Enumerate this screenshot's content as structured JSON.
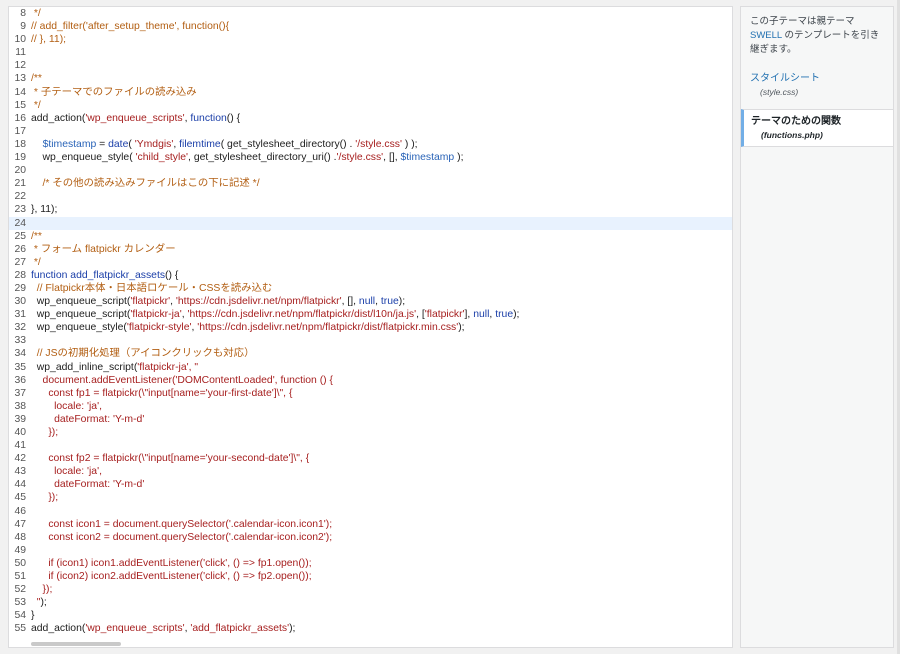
{
  "editor": {
    "lines": [
      {
        "n": "8",
        "tokens": [
          {
            "t": " */",
            "c": "c"
          }
        ]
      },
      {
        "n": "9",
        "tokens": [
          {
            "t": "// add_filter('after_setup_theme', function(){",
            "c": "c"
          }
        ]
      },
      {
        "n": "10",
        "tokens": [
          {
            "t": "// }, 11);",
            "c": "c"
          }
        ]
      },
      {
        "n": "11",
        "tokens": []
      },
      {
        "n": "12",
        "tokens": []
      },
      {
        "n": "13",
        "tokens": [
          {
            "t": "/**",
            "c": "c"
          }
        ]
      },
      {
        "n": "14",
        "tokens": [
          {
            "t": " * 子テーマでのファイルの読み込み",
            "c": "c"
          }
        ]
      },
      {
        "n": "15",
        "tokens": [
          {
            "t": " */",
            "c": "c"
          }
        ]
      },
      {
        "n": "16",
        "tokens": [
          {
            "t": "add_action(",
            "c": "n"
          },
          {
            "t": "'wp_enqueue_scripts'",
            "c": "s"
          },
          {
            "t": ", ",
            "c": "n"
          },
          {
            "t": "function",
            "c": "k"
          },
          {
            "t": "() {",
            "c": "n"
          }
        ]
      },
      {
        "n": "17",
        "tokens": []
      },
      {
        "n": "18",
        "tokens": [
          {
            "t": "    ",
            "c": "n"
          },
          {
            "t": "$timestamp",
            "c": "v"
          },
          {
            "t": " = ",
            "c": "n"
          },
          {
            "t": "date",
            "c": "k"
          },
          {
            "t": "( ",
            "c": "n"
          },
          {
            "t": "'Ymdgis'",
            "c": "s"
          },
          {
            "t": ", ",
            "c": "n"
          },
          {
            "t": "filemtime",
            "c": "k"
          },
          {
            "t": "( get_stylesheet_directory() . ",
            "c": "n"
          },
          {
            "t": "'/style.css'",
            "c": "s"
          },
          {
            "t": " ) );",
            "c": "n"
          }
        ]
      },
      {
        "n": "19",
        "tokens": [
          {
            "t": "    wp_enqueue_style( ",
            "c": "n"
          },
          {
            "t": "'child_style'",
            "c": "s"
          },
          {
            "t": ", get_stylesheet_directory_uri() .",
            "c": "n"
          },
          {
            "t": "'/style.css'",
            "c": "s"
          },
          {
            "t": ", [], ",
            "c": "n"
          },
          {
            "t": "$timestamp",
            "c": "v"
          },
          {
            "t": " );",
            "c": "n"
          }
        ]
      },
      {
        "n": "20",
        "tokens": []
      },
      {
        "n": "21",
        "tokens": [
          {
            "t": "    /* その他の読み込みファイルはこの下に記述 */",
            "c": "c"
          }
        ]
      },
      {
        "n": "22",
        "tokens": []
      },
      {
        "n": "23",
        "tokens": [
          {
            "t": "}, 11);",
            "c": "n"
          }
        ]
      },
      {
        "n": "24",
        "tokens": [],
        "active": true
      },
      {
        "n": "25",
        "tokens": [
          {
            "t": "/**",
            "c": "c"
          }
        ]
      },
      {
        "n": "26",
        "tokens": [
          {
            "t": " * フォーム flatpickr カレンダー",
            "c": "c"
          }
        ]
      },
      {
        "n": "27",
        "tokens": [
          {
            "t": " */",
            "c": "c"
          }
        ]
      },
      {
        "n": "28",
        "tokens": [
          {
            "t": "function",
            "c": "k"
          },
          {
            "t": " ",
            "c": "n"
          },
          {
            "t": "add_flatpickr_assets",
            "c": "k"
          },
          {
            "t": "() {",
            "c": "n"
          }
        ]
      },
      {
        "n": "29",
        "tokens": [
          {
            "t": "  // Flatpickr本体・日本語ロケール・CSSを読み込む",
            "c": "c"
          }
        ]
      },
      {
        "n": "30",
        "tokens": [
          {
            "t": "  wp_enqueue_script(",
            "c": "n"
          },
          {
            "t": "'flatpickr'",
            "c": "s"
          },
          {
            "t": ", ",
            "c": "n"
          },
          {
            "t": "'https://cdn.jsdelivr.net/npm/flatpickr'",
            "c": "s"
          },
          {
            "t": ", [], ",
            "c": "n"
          },
          {
            "t": "null",
            "c": "k"
          },
          {
            "t": ", ",
            "c": "n"
          },
          {
            "t": "true",
            "c": "k"
          },
          {
            "t": ");",
            "c": "n"
          }
        ]
      },
      {
        "n": "31",
        "tokens": [
          {
            "t": "  wp_enqueue_script(",
            "c": "n"
          },
          {
            "t": "'flatpickr-ja'",
            "c": "s"
          },
          {
            "t": ", ",
            "c": "n"
          },
          {
            "t": "'https://cdn.jsdelivr.net/npm/flatpickr/dist/l10n/ja.js'",
            "c": "s"
          },
          {
            "t": ", [",
            "c": "n"
          },
          {
            "t": "'flatpickr'",
            "c": "s"
          },
          {
            "t": "], ",
            "c": "n"
          },
          {
            "t": "null",
            "c": "k"
          },
          {
            "t": ", ",
            "c": "n"
          },
          {
            "t": "true",
            "c": "k"
          },
          {
            "t": ");",
            "c": "n"
          }
        ]
      },
      {
        "n": "32",
        "tokens": [
          {
            "t": "  wp_enqueue_style(",
            "c": "n"
          },
          {
            "t": "'flatpickr-style'",
            "c": "s"
          },
          {
            "t": ", ",
            "c": "n"
          },
          {
            "t": "'https://cdn.jsdelivr.net/npm/flatpickr/dist/flatpickr.min.css'",
            "c": "s"
          },
          {
            "t": ");",
            "c": "n"
          }
        ]
      },
      {
        "n": "33",
        "tokens": []
      },
      {
        "n": "34",
        "tokens": [
          {
            "t": "  // JSの初期化処理（アイコンクリックも対応）",
            "c": "c"
          }
        ]
      },
      {
        "n": "35",
        "tokens": [
          {
            "t": "  wp_add_inline_script(",
            "c": "n"
          },
          {
            "t": "'flatpickr-ja'",
            "c": "s"
          },
          {
            "t": ", \"",
            "c": "s"
          }
        ]
      },
      {
        "n": "36",
        "tokens": [
          {
            "t": "    document.addEventListener('DOMContentLoaded', function () {",
            "c": "s"
          }
        ]
      },
      {
        "n": "37",
        "tokens": [
          {
            "t": "      const fp1 = flatpickr(\\\"input[name='your-first-date']\\\", {",
            "c": "s"
          }
        ]
      },
      {
        "n": "38",
        "tokens": [
          {
            "t": "        locale: 'ja',",
            "c": "s"
          }
        ]
      },
      {
        "n": "39",
        "tokens": [
          {
            "t": "        dateFormat: 'Y-m-d'",
            "c": "s"
          }
        ]
      },
      {
        "n": "40",
        "tokens": [
          {
            "t": "      });",
            "c": "s"
          }
        ]
      },
      {
        "n": "41",
        "tokens": []
      },
      {
        "n": "42",
        "tokens": [
          {
            "t": "      const fp2 = flatpickr(\\\"input[name='your-second-date']\\\", {",
            "c": "s"
          }
        ]
      },
      {
        "n": "43",
        "tokens": [
          {
            "t": "        locale: 'ja',",
            "c": "s"
          }
        ]
      },
      {
        "n": "44",
        "tokens": [
          {
            "t": "        dateFormat: 'Y-m-d'",
            "c": "s"
          }
        ]
      },
      {
        "n": "45",
        "tokens": [
          {
            "t": "      });",
            "c": "s"
          }
        ]
      },
      {
        "n": "46",
        "tokens": []
      },
      {
        "n": "47",
        "tokens": [
          {
            "t": "      const icon1 = document.querySelector('.calendar-icon.icon1');",
            "c": "s"
          }
        ]
      },
      {
        "n": "48",
        "tokens": [
          {
            "t": "      const icon2 = document.querySelector('.calendar-icon.icon2');",
            "c": "s"
          }
        ]
      },
      {
        "n": "49",
        "tokens": []
      },
      {
        "n": "50",
        "tokens": [
          {
            "t": "      if (icon1) icon1.addEventListener('click', () => fp1.open());",
            "c": "s"
          }
        ]
      },
      {
        "n": "51",
        "tokens": [
          {
            "t": "      if (icon2) icon2.addEventListener('click', () => fp2.open());",
            "c": "s"
          }
        ]
      },
      {
        "n": "52",
        "tokens": [
          {
            "t": "    });",
            "c": "s"
          }
        ]
      },
      {
        "n": "53",
        "tokens": [
          {
            "t": "  \"",
            "c": "s"
          },
          {
            "t": ");",
            "c": "n"
          }
        ]
      },
      {
        "n": "54",
        "tokens": [
          {
            "t": "}",
            "c": "n"
          }
        ]
      },
      {
        "n": "55",
        "tokens": [
          {
            "t": "add_action(",
            "c": "n"
          },
          {
            "t": "'wp_enqueue_scripts'",
            "c": "s"
          },
          {
            "t": ", ",
            "c": "n"
          },
          {
            "t": "'add_flatpickr_assets'",
            "c": "s"
          },
          {
            "t": ");",
            "c": "n"
          }
        ]
      }
    ]
  },
  "sidebar": {
    "note_prefix": "この子テーマは親テーマ",
    "note_link": "SWELL",
    "note_suffix": "のテンプレートを引き継ぎます。",
    "files": [
      {
        "title": "スタイルシート",
        "filename": "(style.css)",
        "selected": false
      },
      {
        "title": "テーマのための関数",
        "filename": "(functions.php)",
        "selected": true
      }
    ]
  },
  "colors": {
    "keyword": "#1a3ea8",
    "string": "#a61f1f",
    "variable": "#2a64b8",
    "comment": "#b25e12",
    "active_line": "#e8f2fe",
    "link": "#2271b1"
  }
}
